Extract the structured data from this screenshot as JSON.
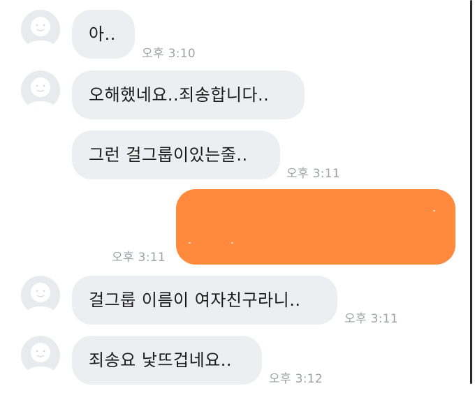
{
  "colors": {
    "received_bubble": "#eceef1",
    "sent_bubble": "#ff8a3d",
    "timestamp": "#9ea2a8",
    "avatar_bg": "#e9eaee"
  },
  "icons": {
    "avatar": "default-profile-icon"
  },
  "messages": [
    {
      "sender": "other",
      "text": "아..",
      "time": "오후 3:10"
    },
    {
      "sender": "other",
      "text": "오해했네요..죄송합니다..",
      "time": ""
    },
    {
      "sender": "other",
      "text": "그런 걸그룹이있는줄..",
      "time": "오후 3:11"
    },
    {
      "sender": "me",
      "text": "",
      "time": "오후 3:11",
      "redacted": true
    },
    {
      "sender": "other",
      "text": "걸그룹 이름이 여자친구라니..",
      "time": "오후 3:11"
    },
    {
      "sender": "other",
      "text": "죄송요 낯뜨겁네요..",
      "time": "오후 3:12"
    }
  ]
}
